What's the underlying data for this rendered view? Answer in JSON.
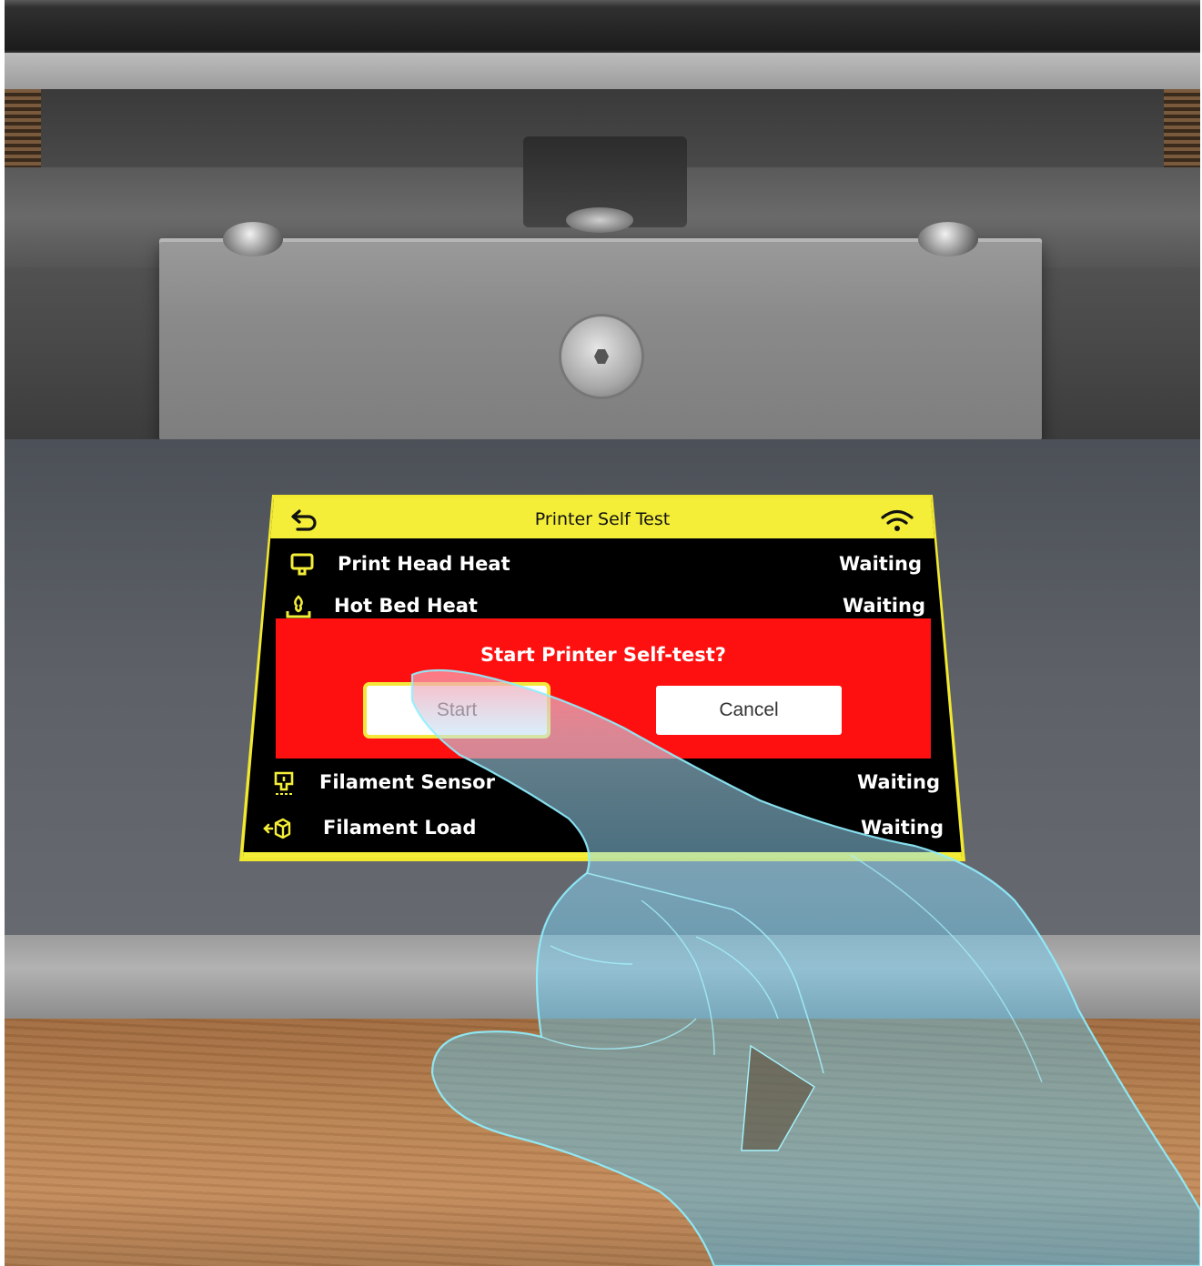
{
  "screen": {
    "title": "Printer Self Test",
    "tests": [
      {
        "label": "Print Head Heat",
        "status": "Waiting",
        "icon": "print-head-icon"
      },
      {
        "label": "Hot Bed Heat",
        "status": "Waiting",
        "icon": "hot-bed-icon"
      },
      {
        "label": "Filament Sensor",
        "status": "Waiting",
        "icon": "filament-sensor-icon"
      },
      {
        "label": "Filament Load",
        "status": "Waiting",
        "icon": "filament-load-icon"
      }
    ],
    "dialog": {
      "question": "Start Printer Self-test?",
      "start_label": "Start",
      "cancel_label": "Cancel"
    }
  },
  "colors": {
    "title_bar": "#f4ee38",
    "dialog": "#ff1010",
    "screen_bg": "#000000",
    "hand": "#6fd6ff"
  }
}
